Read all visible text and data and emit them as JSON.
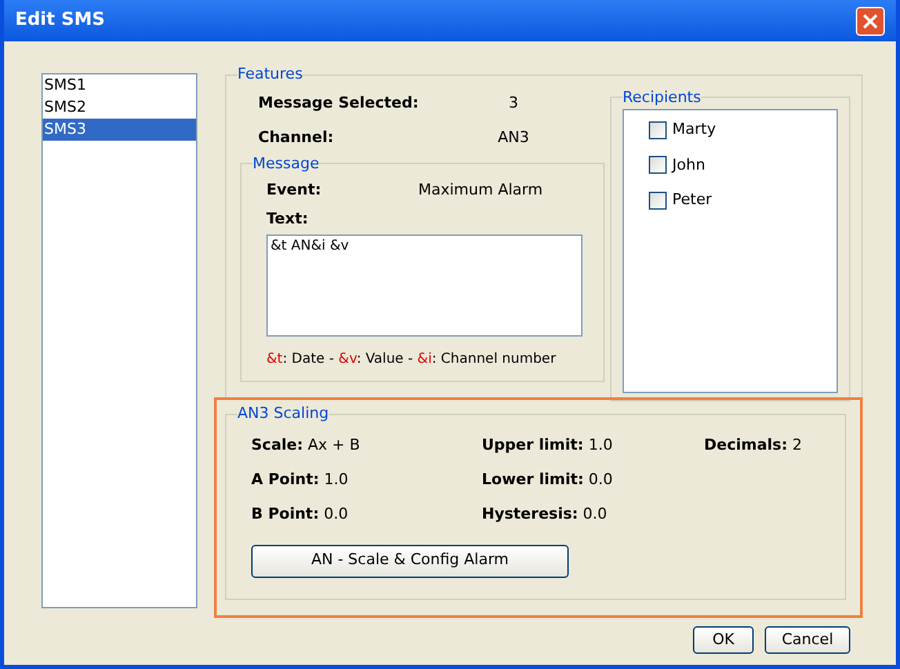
{
  "window": {
    "title": "Edit SMS"
  },
  "messages": [
    {
      "label": "SMS1",
      "selected": false
    },
    {
      "label": "SMS2",
      "selected": false
    },
    {
      "label": "SMS3",
      "selected": true
    }
  ],
  "features": {
    "title": "Features",
    "fields": [
      {
        "label": "Message Selected:",
        "value": "3"
      },
      {
        "label": "Channel:",
        "value": "AN3"
      }
    ]
  },
  "message": {
    "title": "Message",
    "event_label": "Event:",
    "event_value": "Maximum Alarm",
    "text_label": "Text:",
    "text_value": "&t AN&i &v",
    "legend": [
      {
        "code": "&t",
        "label": ": Date - "
      },
      {
        "code": "&v",
        "label": ": Value - "
      },
      {
        "code": "&i",
        "label": ": Channel number"
      }
    ]
  },
  "recipients": {
    "title": "Recipients",
    "items": [
      {
        "name": "Marty",
        "checked": false
      },
      {
        "name": "John",
        "checked": false
      },
      {
        "name": "Peter",
        "checked": false
      }
    ]
  },
  "scaling": {
    "title": "AN3 Scaling",
    "columns": [
      [
        {
          "label": "Scale:",
          "value": "Ax + B"
        },
        {
          "label": "A Point:",
          "value": "1.0"
        },
        {
          "label": "B Point:",
          "value": "0.0"
        }
      ],
      [
        {
          "label": "Upper limit:",
          "value": "1.0"
        },
        {
          "label": "Lower limit:",
          "value": "0.0"
        },
        {
          "label": "Hysteresis:",
          "value": "0.0"
        }
      ],
      [
        {
          "label": "Decimals:",
          "value": "2"
        }
      ]
    ],
    "button": "AN - Scale & Config Alarm"
  },
  "buttons": [
    "OK",
    "Cancel"
  ]
}
